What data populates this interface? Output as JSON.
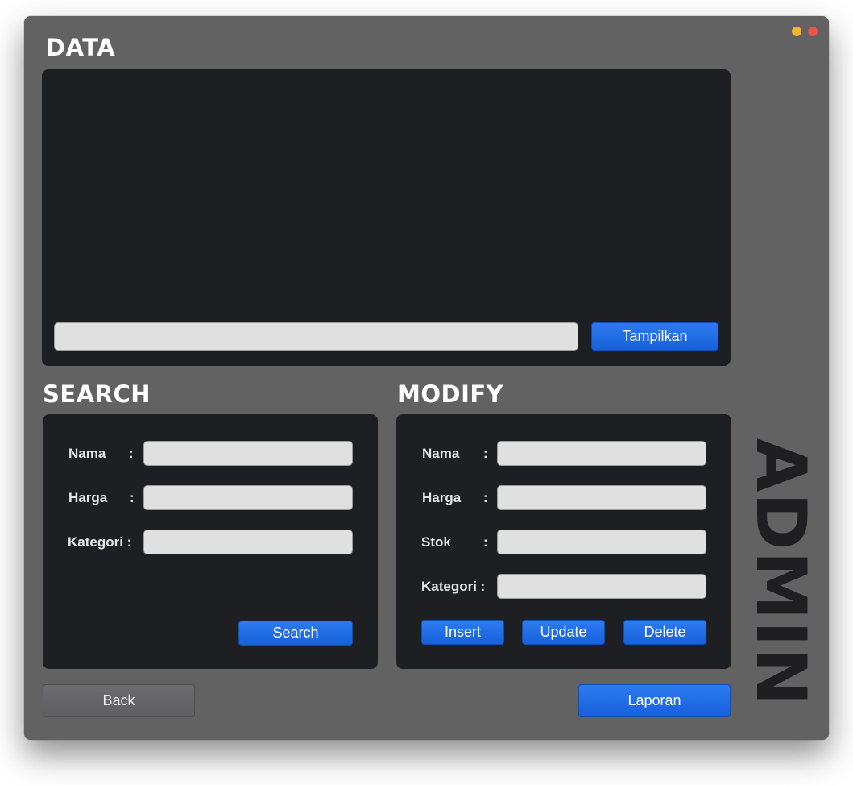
{
  "window": {
    "title": "ADMIN"
  },
  "data_section": {
    "heading": "DATA",
    "input_value": "",
    "button_label": "Tampilkan"
  },
  "search_section": {
    "heading": "SEARCH",
    "labels": {
      "nama": "Nama",
      "harga": "Harga",
      "kategori": "Kategori :"
    },
    "colon": ":",
    "values": {
      "nama": "",
      "harga": "",
      "kategori": ""
    },
    "button_label": "Search"
  },
  "modify_section": {
    "heading": "MODIFY",
    "labels": {
      "nama": "Nama",
      "harga": "Harga",
      "stok": "Stok",
      "kategori": "Kategori :"
    },
    "colon": ":",
    "values": {
      "nama": "",
      "harga": "",
      "stok": "",
      "kategori": ""
    },
    "buttons": {
      "insert": "Insert",
      "update": "Update",
      "delete": "Delete"
    }
  },
  "footer": {
    "back_label": "Back",
    "laporan_label": "Laporan"
  },
  "colors": {
    "window_bg": "#626262",
    "panel_bg": "#1e1f22",
    "accent_blue": "#1a66e0",
    "field_bg": "#e0e0e0"
  }
}
